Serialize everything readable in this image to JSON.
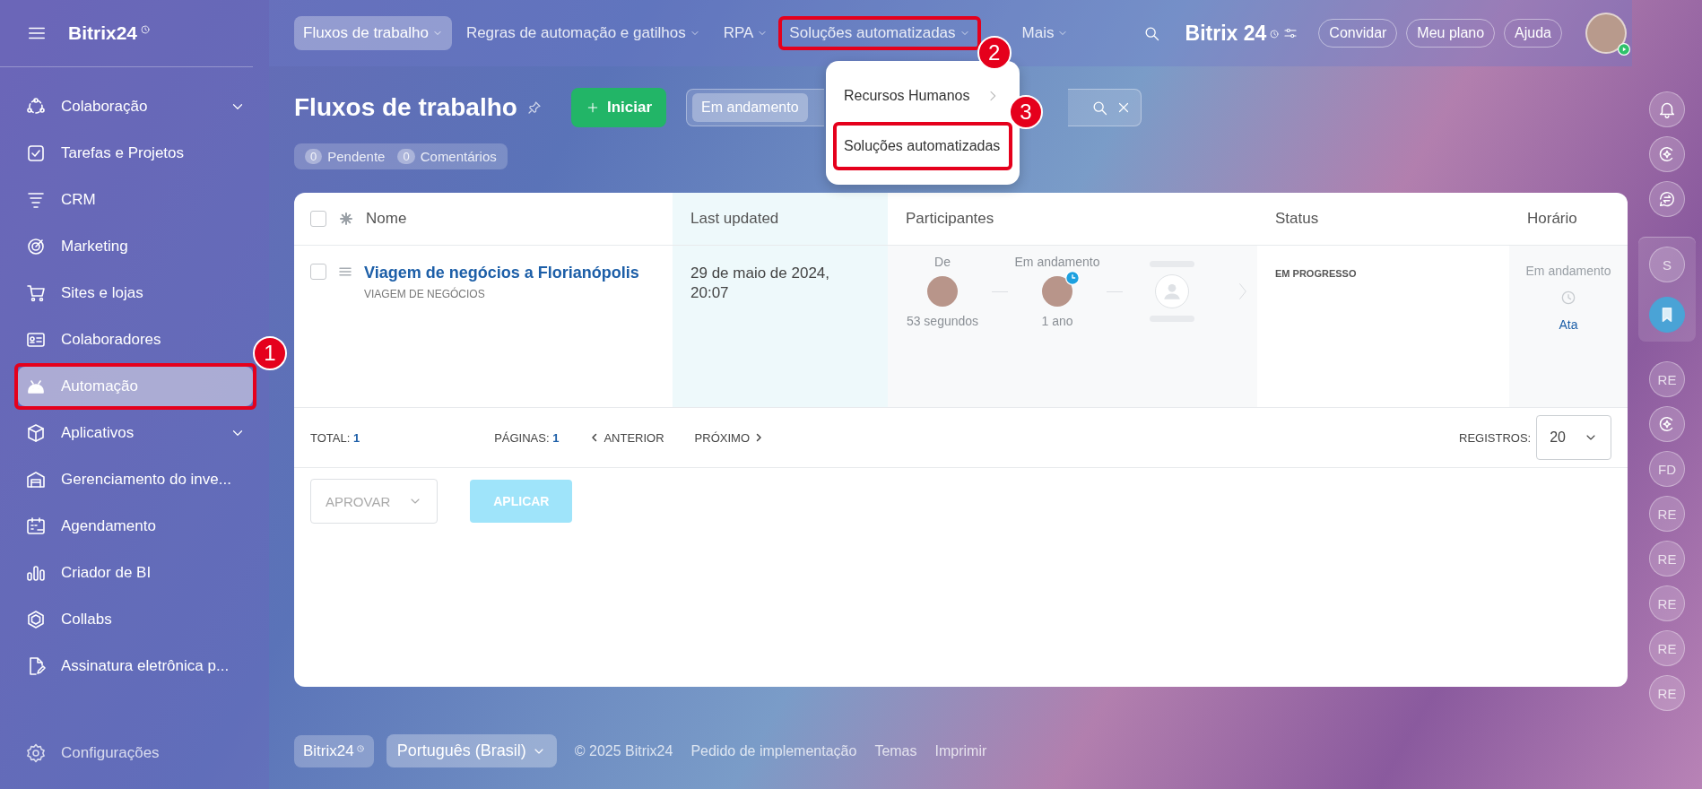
{
  "sidebar": {
    "logo": "Bitrix24",
    "items": [
      {
        "label": "Colaboração",
        "expandable": true,
        "selected": false
      },
      {
        "label": "Tarefas e Projetos",
        "expandable": false,
        "selected": false
      },
      {
        "label": "CRM",
        "expandable": false,
        "selected": false
      },
      {
        "label": "Marketing",
        "expandable": false,
        "selected": false
      },
      {
        "label": "Sites e lojas",
        "expandable": false,
        "selected": false
      },
      {
        "label": "Colaboradores",
        "expandable": false,
        "selected": false
      },
      {
        "label": "Automação",
        "expandable": false,
        "selected": true,
        "callout": "1"
      },
      {
        "label": "Aplicativos",
        "expandable": true,
        "selected": false
      },
      {
        "label": "Gerenciamento do inve...",
        "expandable": false,
        "selected": false
      },
      {
        "label": "Agendamento",
        "expandable": false,
        "selected": false
      },
      {
        "label": "Criador de BI",
        "expandable": false,
        "selected": false
      },
      {
        "label": "Collabs",
        "expandable": false,
        "selected": false
      },
      {
        "label": "Assinatura eletrônica p...",
        "expandable": false,
        "selected": false
      }
    ],
    "settings": "Configurações"
  },
  "top_nav": {
    "items": [
      {
        "label": "Fluxos de trabalho",
        "selected": true
      },
      {
        "label": "Regras de automação e gatilhos",
        "selected": false
      },
      {
        "label": "RPA",
        "selected": false
      },
      {
        "label": "Soluções automatizadas",
        "selected": false,
        "callout": "2"
      },
      {
        "label": "Mais",
        "selected": false
      }
    ],
    "logo": "Bitrix 24",
    "buttons": [
      "Convidar",
      "Meu plano",
      "Ajuda"
    ]
  },
  "dropdown": {
    "items": [
      {
        "label": "Recursos Humanos",
        "submenu": true
      },
      {
        "label": "Soluções automatizadas",
        "submenu": false,
        "callout": "3"
      }
    ]
  },
  "page": {
    "title": "Fluxos de trabalho",
    "start_button": "Iniciar",
    "filter_chip": "Em andamento",
    "counters": [
      {
        "count": "0",
        "label": "Pendente"
      },
      {
        "count": "0",
        "label": "Comentários"
      }
    ]
  },
  "table": {
    "all_checked": false,
    "columns": [
      {
        "label": "Nome",
        "highlighted": false
      },
      {
        "label": "Last updated",
        "highlighted": true
      },
      {
        "label": "Participantes",
        "highlighted": false
      },
      {
        "label": "Status",
        "highlighted": false
      },
      {
        "label": "Horário",
        "highlighted": false
      }
    ],
    "rows": [
      {
        "checked": false,
        "name": "Viagem de negócios a Florianópolis",
        "type": "VIAGEM DE NEGÓCIOS",
        "updated": "29 de maio de 2024, 20:07",
        "participants": [
          {
            "kind": "person",
            "label": "De",
            "time": "53 segundos",
            "clock": false
          },
          {
            "kind": "person",
            "label": "Em andamento",
            "time": "1 ano",
            "clock": true
          },
          {
            "kind": "empty"
          }
        ],
        "status": "EM PROGRESSO",
        "time_label": "Em andamento",
        "time_link": "Ata"
      }
    ]
  },
  "pager": {
    "total_label": "TOTAL:",
    "total": "1",
    "pages_label": "PÁGINAS:",
    "page": "1",
    "prev": "ANTERIOR",
    "next": "PRÓXIMO",
    "records_label": "REGISTROS:",
    "records": "20"
  },
  "actions": {
    "select": "APROVAR",
    "apply": "APLICAR"
  },
  "footer": {
    "logo": "Bitrix24",
    "language": "Português (Brasil)",
    "copyright": "© 2025 Bitrix24",
    "links": [
      "Pedido de implementação",
      "Temas",
      "Imprimir"
    ]
  },
  "rail": {
    "items": [
      {
        "kind": "bell"
      },
      {
        "kind": "spark"
      },
      {
        "kind": "chat"
      },
      {
        "kind": "initials",
        "text": "S",
        "grouped": true
      },
      {
        "kind": "bookmark",
        "grouped": true
      },
      {
        "kind": "initials",
        "text": "RE"
      },
      {
        "kind": "spark"
      },
      {
        "kind": "initials",
        "text": "FD"
      },
      {
        "kind": "initials",
        "text": "RE"
      },
      {
        "kind": "initials",
        "text": "RE"
      },
      {
        "kind": "initials",
        "text": "RE"
      },
      {
        "kind": "initials",
        "text": "RE"
      },
      {
        "kind": "initials",
        "text": "RE"
      }
    ]
  }
}
